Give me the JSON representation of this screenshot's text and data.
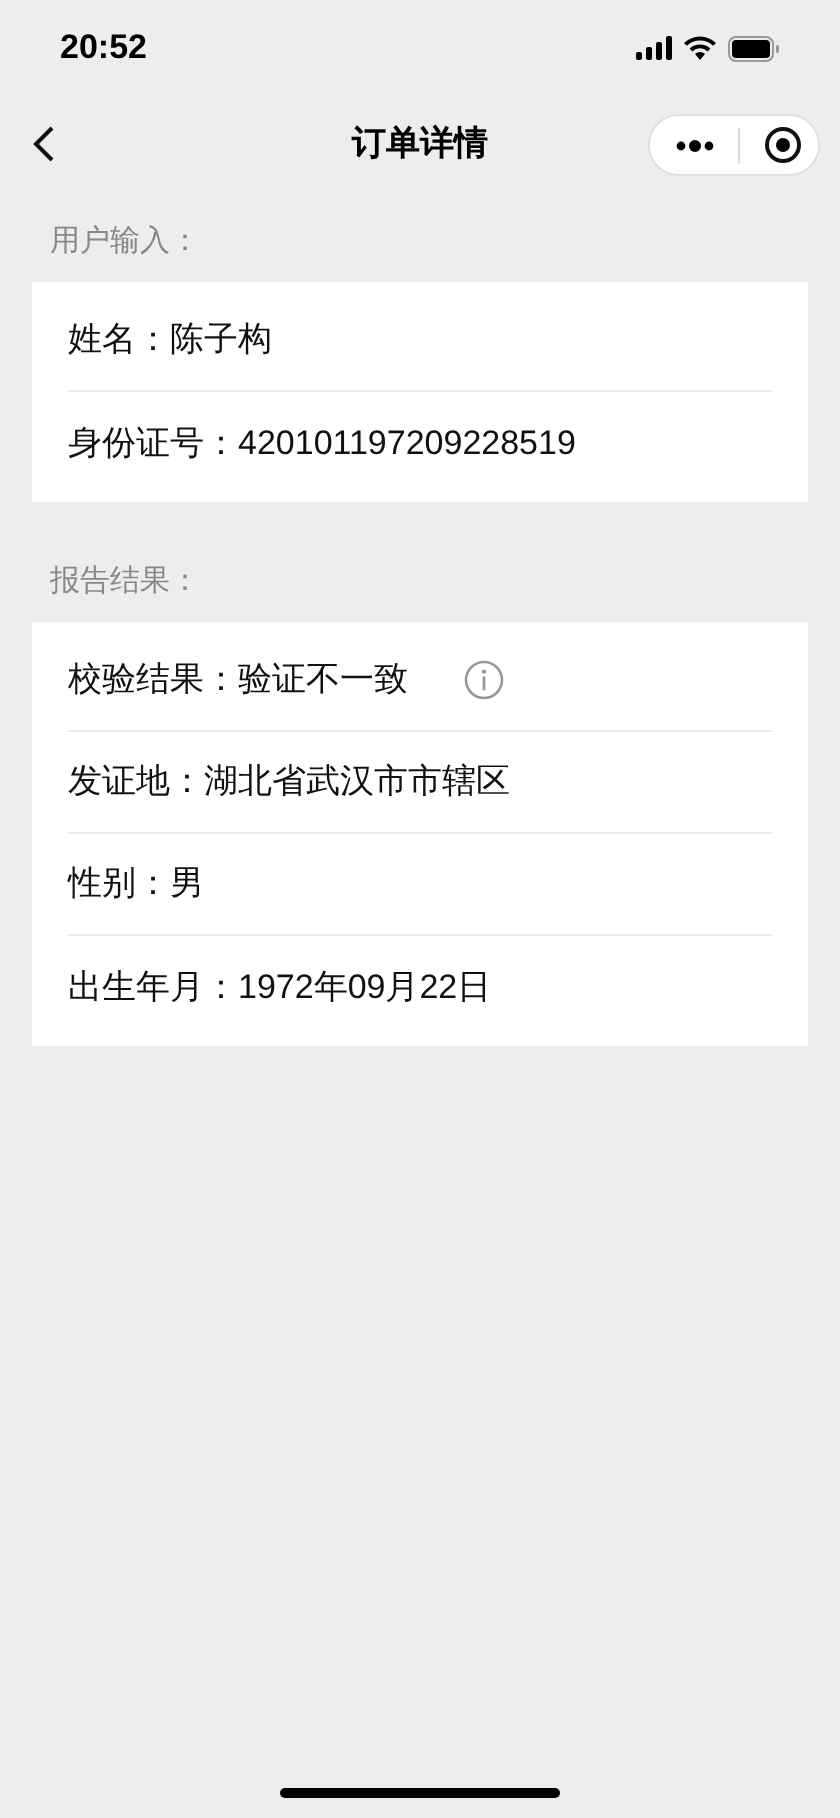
{
  "status_bar": {
    "time": "20:52"
  },
  "nav": {
    "title": "订单详情"
  },
  "sections": [
    {
      "title": "用户输入：",
      "rows": [
        {
          "kind": "plain",
          "label": "姓名：",
          "value": "陈子构"
        },
        {
          "kind": "plain",
          "label": "身份证号：",
          "value": "420101197209228519"
        }
      ]
    },
    {
      "title": "报告结果：",
      "rows": [
        {
          "kind": "info",
          "label": "校验结果：",
          "value": "验证不一致"
        },
        {
          "kind": "plain",
          "label": "发证地：",
          "value": "湖北省武汉市市辖区"
        },
        {
          "kind": "plain",
          "label": "性别：",
          "value": "男"
        },
        {
          "kind": "plain",
          "label": "出生年月：",
          "value": "1972年09月22日"
        }
      ]
    }
  ]
}
